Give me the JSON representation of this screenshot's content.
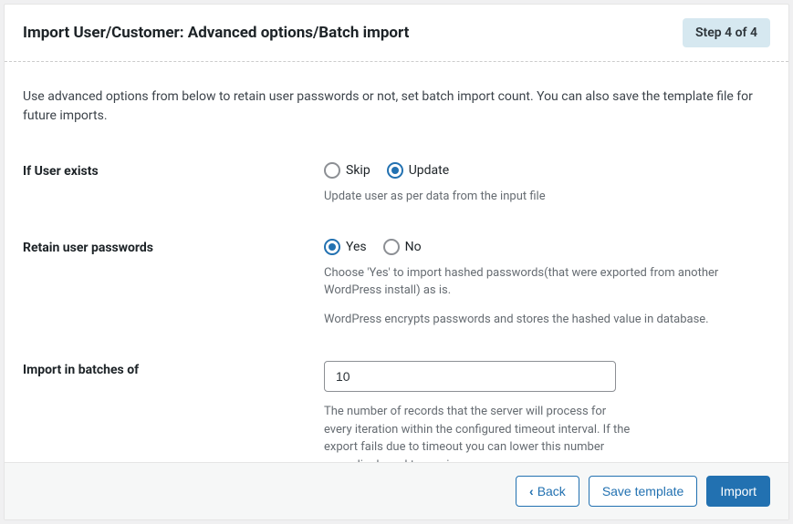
{
  "header": {
    "title": "Import User/Customer: Advanced options/Batch import",
    "step_label": "Step 4 of 4"
  },
  "intro": "Use advanced options from below to retain user passwords or not, set batch import count. You can also save the template file for future imports.",
  "fields": {
    "if_user_exists": {
      "label": "If User exists",
      "options": {
        "skip": "Skip",
        "update": "Update"
      },
      "selected": "update",
      "help": "Update user as per data from the input file"
    },
    "retain_passwords": {
      "label": "Retain user passwords",
      "options": {
        "yes": "Yes",
        "no": "No"
      },
      "selected": "yes",
      "help1": "Choose 'Yes' to import hashed passwords(that were exported from another WordPress install) as is.",
      "help2": "WordPress encrypts passwords and stores the hashed value in database."
    },
    "batch": {
      "label": "Import in batches of",
      "value": "10",
      "help": "The number of records that the server will process for every iteration within the configured timeout interval. If the export fails due to timeout you can lower this number accordingly and try again."
    }
  },
  "footer": {
    "back": "Back",
    "save_template": "Save template",
    "import": "Import"
  }
}
